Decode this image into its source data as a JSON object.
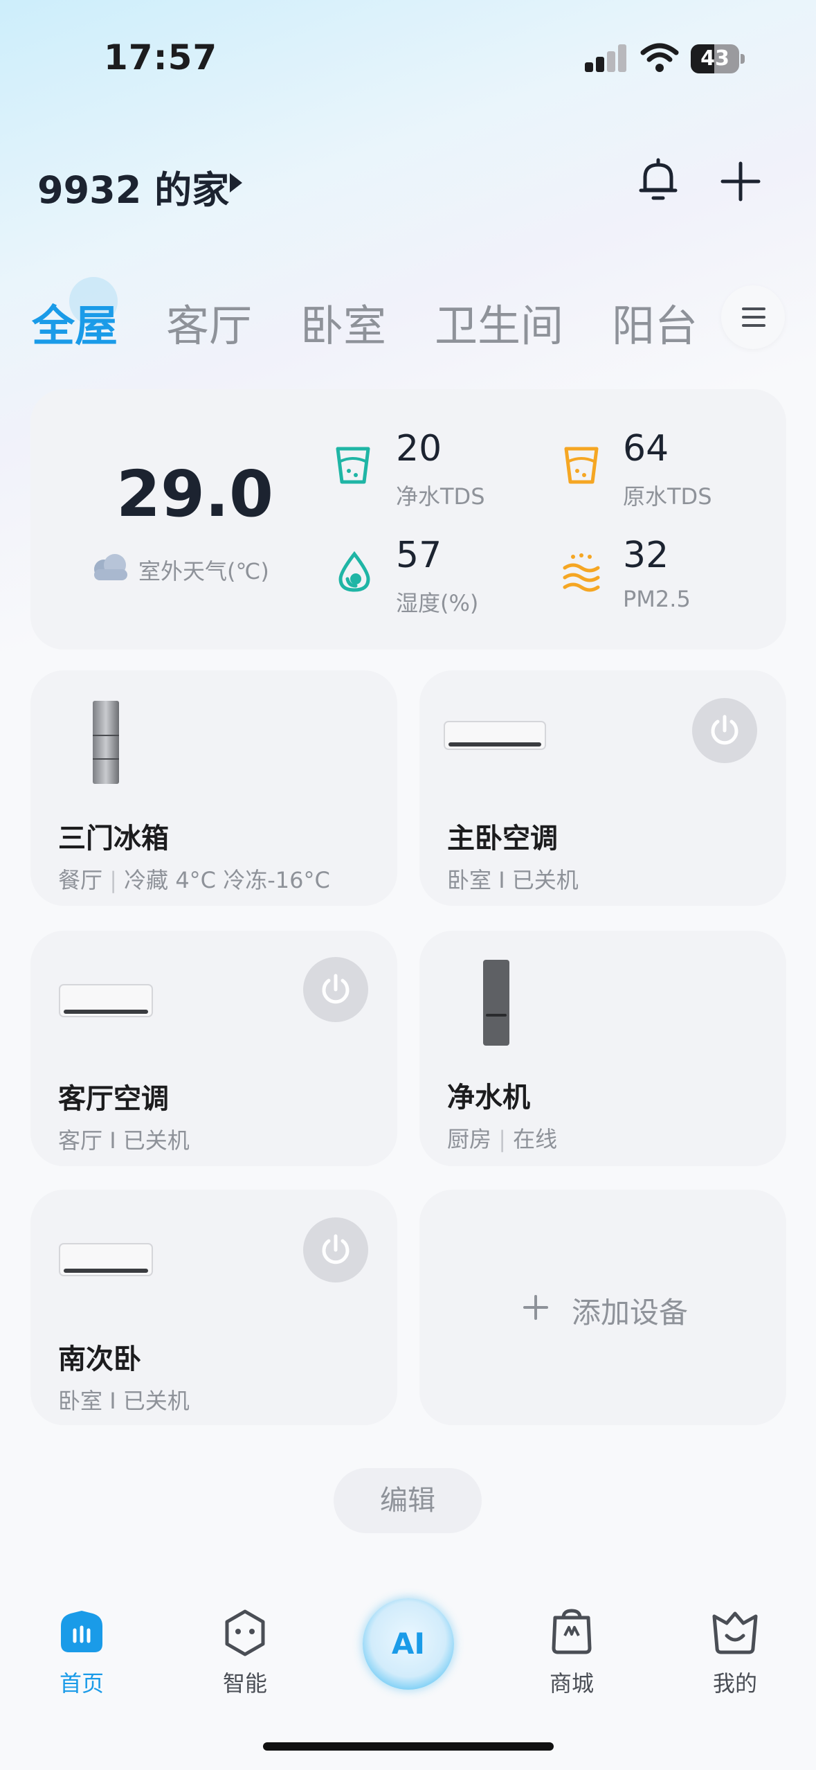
{
  "status_bar": {
    "time": "17:57",
    "battery": "43"
  },
  "header": {
    "home_title": "9932 的家"
  },
  "tabs": [
    {
      "label": "全屋",
      "active": true
    },
    {
      "label": "客厅",
      "active": false
    },
    {
      "label": "卧室",
      "active": false
    },
    {
      "label": "卫生间",
      "active": false
    },
    {
      "label": "阳台",
      "active": false
    }
  ],
  "environment": {
    "temperature": "29.0",
    "weather_label": "室外天气(℃)",
    "metrics": [
      {
        "value": "20",
        "label": "净水TDS",
        "icon": "pure-water-cup-icon",
        "color": "#1fb5a5"
      },
      {
        "value": "64",
        "label": "原水TDS",
        "icon": "raw-water-cup-icon",
        "color": "#f5a623"
      },
      {
        "value": "57",
        "label": "湿度(%)",
        "icon": "humidity-drop-icon",
        "color": "#1fb5a5"
      },
      {
        "value": "32",
        "label": "PM2.5",
        "icon": "pm25-waves-icon",
        "color": "#f5a623"
      }
    ]
  },
  "devices": [
    {
      "name": "三门冰箱",
      "room": "餐厅",
      "status": "冷藏 4°C 冷冻-16°C",
      "icon": "fridge-icon",
      "power_button": false
    },
    {
      "name": "主卧空调",
      "room": "卧室",
      "status": "已关机",
      "icon": "air-conditioner-icon",
      "power_button": true
    },
    {
      "name": "客厅空调",
      "room": "客厅",
      "status": "已关机",
      "icon": "air-conditioner-icon",
      "power_button": true
    },
    {
      "name": "净水机",
      "room": "厨房",
      "status": "在线",
      "icon": "water-purifier-icon",
      "power_button": false
    },
    {
      "name": "南次卧",
      "room": "卧室",
      "status": "已关机",
      "icon": "air-conditioner-icon",
      "power_button": true
    }
  ],
  "add_device_label": "添加设备",
  "edit_label": "编辑",
  "bottom_nav": [
    {
      "label": "首页",
      "icon": "home-icon",
      "active": true
    },
    {
      "label": "智能",
      "icon": "smart-face-icon",
      "active": false
    },
    {
      "label": "AI",
      "icon": "ai-icon",
      "active": false
    },
    {
      "label": "商城",
      "icon": "mall-icon",
      "active": false
    },
    {
      "label": "我的",
      "icon": "profile-icon",
      "active": false
    }
  ],
  "colors": {
    "accent": "#1a9be8",
    "card_bg": "#f2f3f6",
    "teal": "#1fb5a5",
    "orange": "#f5a623"
  }
}
